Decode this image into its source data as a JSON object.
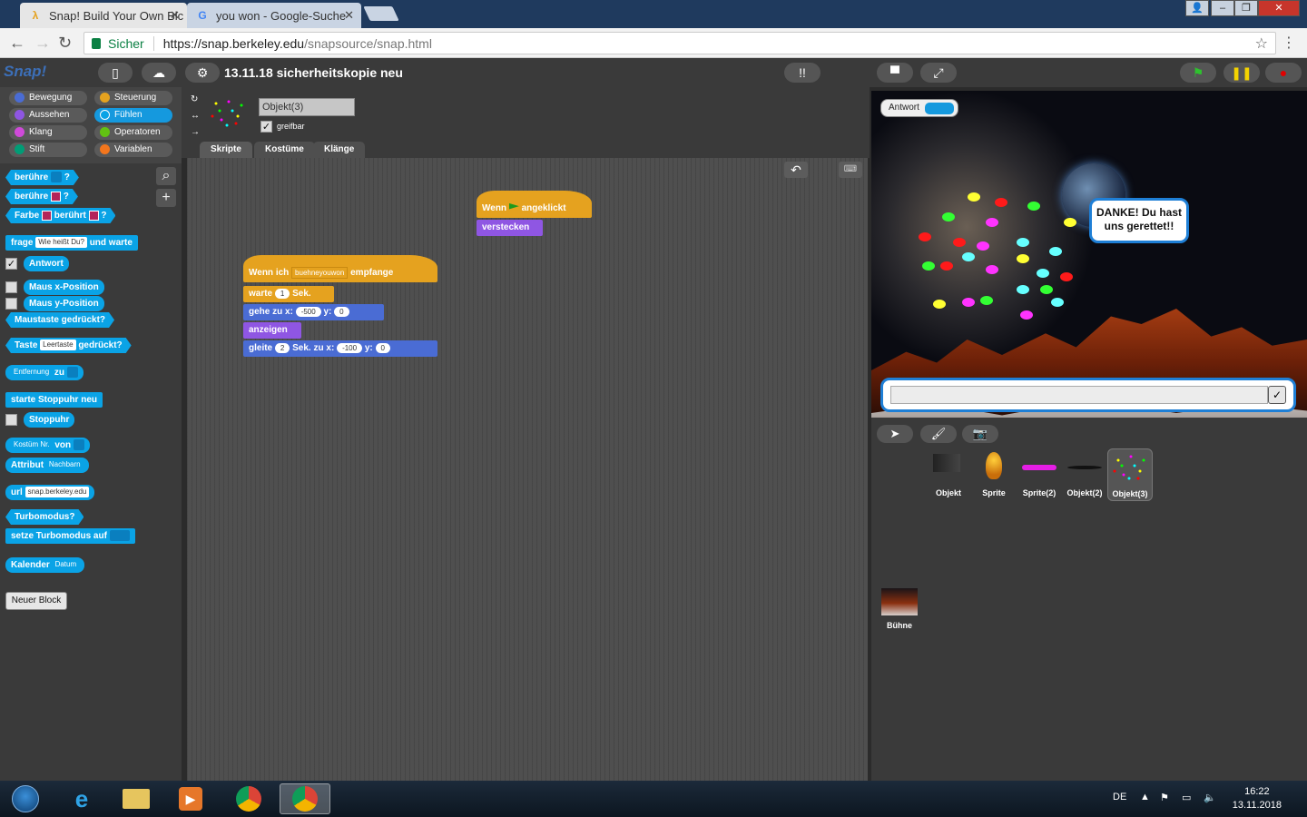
{
  "browser": {
    "tabs": [
      {
        "title": "Snap! Build Your Own Blc",
        "favicon": "λ"
      },
      {
        "title": "you won - Google-Suche",
        "favicon": "G"
      }
    ],
    "secure_label": "Sicher",
    "url_host": "https://snap.berkeley.edu",
    "url_path": "/snapsource/snap.html"
  },
  "snap": {
    "logo": "Snap!",
    "project_title": "13.11.18 sicherheitskopie neu",
    "categories": [
      "Bewegung",
      "Steuerung",
      "Aussehen",
      "Fühlen",
      "Klang",
      "Operatoren",
      "Stift",
      "Variablen"
    ],
    "category_colors": [
      "#4a6cd4",
      "#e5a21f",
      "#8f56e3",
      "#0aa3e6",
      "#cf4ad9",
      "#62c213",
      "#009d76",
      "#f3761d"
    ],
    "palette": {
      "touching": "berühre",
      "question": "?",
      "color": "Farbe",
      "touches": "berührt",
      "ask": "frage",
      "ask_default": "Wie heißt Du?",
      "and_wait": "und warte",
      "answer": "Antwort",
      "mouse_x": "Maus x-Position",
      "mouse_y": "Maus y-Position",
      "mouse_down": "Maustaste gedrückt?",
      "key": "Taste",
      "key_default": "Leertaste",
      "key_pressed": "gedrückt?",
      "distance": "Entfernung",
      "to": "zu",
      "reset_timer": "starte Stoppuhr neu",
      "timer": "Stoppuhr",
      "costume_num": "Kostüm Nr.",
      "of": "von",
      "attribute": "Attribut",
      "neighbors": "Nachbarn",
      "url": "url",
      "url_default": "snap.berkeley.edu",
      "turbo": "Turbomodus?",
      "set_turbo": "setze Turbomodus auf",
      "calendar": "Kalender",
      "date": "Datum",
      "new_block": "Neuer Block"
    },
    "sprite": {
      "name": "Objekt(3)",
      "draggable": "greifbar",
      "tabs": [
        "Skripte",
        "Kostüme",
        "Klänge"
      ]
    },
    "scripts": {
      "flag_hat_when": "Wenn",
      "flag_hat_clicked": "angeklickt",
      "hide": "verstecken",
      "receive_when": "Wenn ich",
      "receive_msg": "buehneyouwon",
      "receive_end": "empfange",
      "wait": "warte",
      "wait_val": "1",
      "secs": "Sek.",
      "goto": "gehe zu x:",
      "goto_x": "-500",
      "goto_y_label": "y:",
      "goto_y": "0",
      "show": "anzeigen",
      "glide": "gleite",
      "glide_secs": "2",
      "glide_to": "Sek. zu x:",
      "glide_x": "-100",
      "glide_y": "0"
    },
    "stage": {
      "watcher_label": "Antwort",
      "bubble_text": "DANKE! Du hast uns gerettet!!"
    },
    "corral": {
      "sprites": [
        "Objekt",
        "Sprite",
        "Sprite(2)",
        "Objekt(2)",
        "Objekt(3)"
      ],
      "stage_label": "Bühne"
    }
  },
  "taskbar": {
    "lang": "DE",
    "time": "16:22",
    "date": "13.11.2018"
  }
}
